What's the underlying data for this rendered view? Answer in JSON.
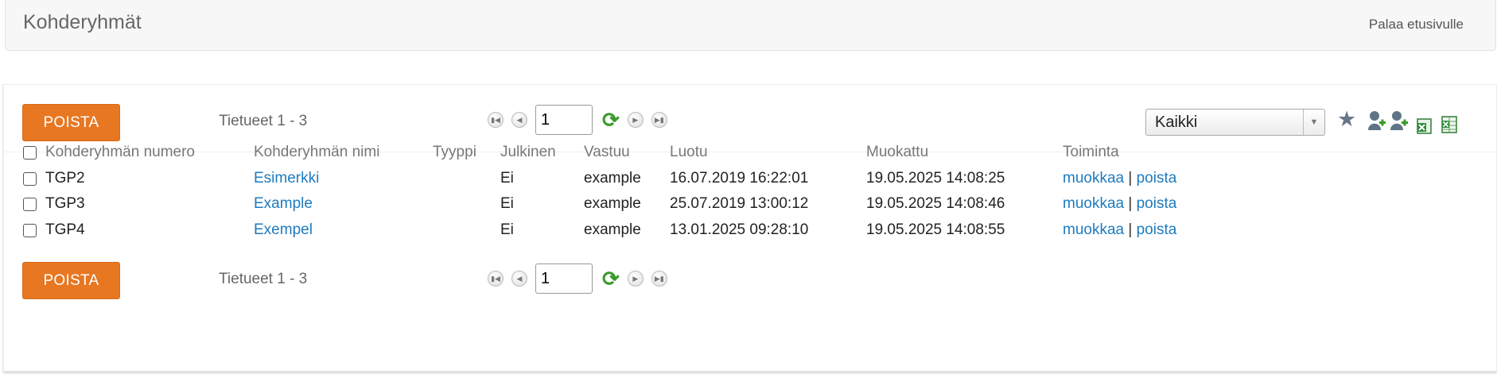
{
  "header": {
    "title": "Kohderyhmät",
    "back_link": "Palaa etusivulle"
  },
  "toolbar": {
    "delete_label": "POISTA",
    "records_label": "Tietueet 1 - 3",
    "page_value": "1",
    "filter_selected": "Kaikki"
  },
  "table": {
    "columns": [
      "Kohderyhmän numero",
      "Kohderyhmän nimi",
      "Tyyppi",
      "Julkinen",
      "Vastuu",
      "Luotu",
      "Muokattu",
      "Toiminta"
    ],
    "rows": [
      {
        "number": "TGP2",
        "name": "Esimerkki",
        "type": "",
        "public": "Ei",
        "owner": "example",
        "created": "16.07.2019 16:22:01",
        "modified": "19.05.2025 14:08:25",
        "edit": "muokkaa",
        "sep": "|",
        "delete": "poista"
      },
      {
        "number": "TGP3",
        "name": "Example",
        "type": "",
        "public": "Ei",
        "owner": "example",
        "created": "25.07.2019 13:00:12",
        "modified": "19.05.2025 14:08:46",
        "edit": "muokkaa",
        "sep": "|",
        "delete": "poista"
      },
      {
        "number": "TGP4",
        "name": "Exempel",
        "type": "",
        "public": "Ei",
        "owner": "example",
        "created": "13.01.2025 09:28:10",
        "modified": "19.05.2025 14:08:55",
        "edit": "muokkaa",
        "sep": "|",
        "delete": "poista"
      }
    ]
  },
  "icons": {
    "first_page": "first-page-icon",
    "prev_page": "prev-page-icon",
    "refresh": "refresh-icon",
    "next_page": "next-page-icon",
    "last_page": "last-page-icon",
    "favorite": "star-icon",
    "add_contact": "add-contact-icon",
    "add_contacts": "add-contacts-icon",
    "excel_export": "excel-icon",
    "excel_export_all": "excel-all-icon"
  },
  "colors": {
    "delete_button": "#e87722",
    "link": "#1e7bbf",
    "refresh": "#3a9a2a"
  }
}
